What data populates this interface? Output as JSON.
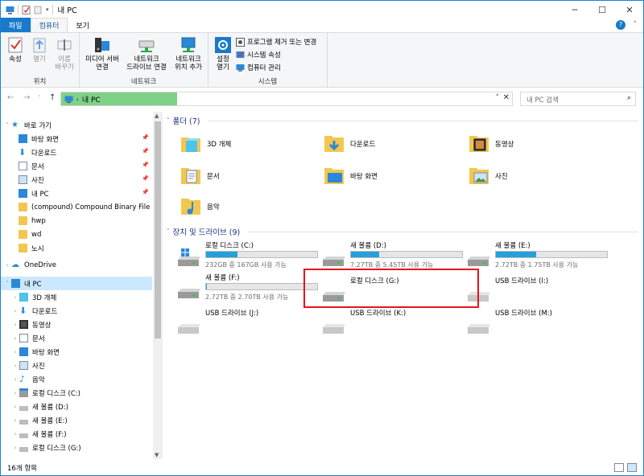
{
  "window": {
    "title": "내 PC"
  },
  "tabs": {
    "file": "파일",
    "computer": "컴퓨터",
    "view": "보기"
  },
  "ribbon": {
    "location": {
      "label": "위치",
      "properties": "속성",
      "open": "열기",
      "rename_1": "이름",
      "rename_2": "바꾸기"
    },
    "network": {
      "label": "네트워크",
      "media_1": "미디어 서버",
      "media_2": "연결",
      "map_1": "네트워크",
      "map_2": "드라이브 연결",
      "add_1": "네트워크",
      "add_2": "위치 추가"
    },
    "system": {
      "label": "시스템",
      "settings_1": "설정",
      "settings_2": "열기",
      "uninstall": "프로그램 제거 또는 변경",
      "sysprops": "시스템 속성",
      "manage": "컴퓨터 관리"
    }
  },
  "address": {
    "path": "내 PC",
    "search_placeholder": "내 PC 검색"
  },
  "nav": {
    "quick_access": "바로 가기",
    "quick_items": [
      "바탕 화면",
      "다운로드",
      "문서",
      "사진",
      "내 PC",
      "(compound) Compound Binary File (OL",
      "hwp",
      "wd",
      "노시"
    ],
    "onedrive": "OneDrive",
    "this_pc": "내 PC",
    "pc_items": [
      "3D 개체",
      "다운로드",
      "동영상",
      "문서",
      "바탕 화면",
      "사진",
      "음악",
      "로컬 디스크 (C:)",
      "새 볼륨 (D:)",
      "새 볼륨 (E:)",
      "새 볼륨 (F:)",
      "로컬 디스크 (G:)"
    ]
  },
  "folders": {
    "header": "폴더 (7)",
    "items": [
      "3D 개체",
      "다운로드",
      "동영상",
      "문서",
      "바탕 화면",
      "사진",
      "음악"
    ]
  },
  "drives": {
    "header": "장치 및 드라이브 (9)",
    "items": [
      {
        "name": "로컬 디스크 (C:)",
        "free": "232GB 중 167GB 사용 가능",
        "used": 0.28
      },
      {
        "name": "새 볼륨 (D:)",
        "free": "7.27TB 중 5.45TB 사용 가능",
        "used": 0.25
      },
      {
        "name": "새 볼륨 (E:)",
        "free": "2.72TB 중 1.75TB 사용 가능",
        "used": 0.36
      },
      {
        "name": "새 볼륨 (F:)",
        "free": "2.72TB 중 2.70TB 사용 가능",
        "used": 0.01
      },
      {
        "name": "로컬 디스크 (G:)"
      },
      {
        "name": "USB 드라이브 (I:)"
      },
      {
        "name": "USB 드라이브 (J:)"
      },
      {
        "name": "USB 드라이브 (K:)"
      },
      {
        "name": "USB 드라이브 (M:)"
      }
    ]
  },
  "status": {
    "count": "16개 항목"
  },
  "colors": {
    "accent": "#1979ca",
    "bar": "#26a0da",
    "highlight": "#e8141b",
    "path_highlight": "#7ed187"
  }
}
